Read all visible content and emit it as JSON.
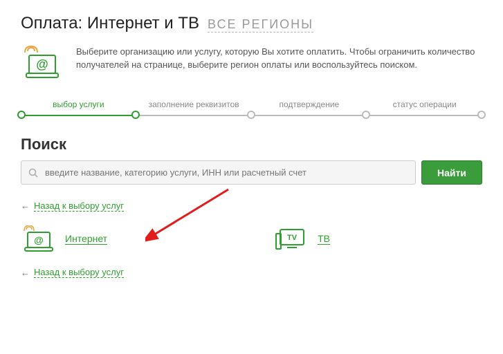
{
  "header": {
    "title": "Оплата: Интернет и ТВ",
    "region_link": "ВСЕ РЕГИОНЫ"
  },
  "info": {
    "text": "Выберите организацию или услугу, которую Вы хотите оплатить. Чтобы ограничить количество получателей на странице, выберите регион оплаты или воспользуйтесь поиском."
  },
  "steps": {
    "s1": "выбор услуги",
    "s2": "заполнение реквизитов",
    "s3": "подтверждение",
    "s4": "статус операции"
  },
  "search": {
    "heading": "Поиск",
    "placeholder": "введите название, категорию услуги, ИНН или расчетный счет",
    "button": "Найти"
  },
  "back": {
    "arrow": "←",
    "label": "Назад к выбору услуг"
  },
  "categories": {
    "internet": "Интернет",
    "tv": "ТВ"
  }
}
